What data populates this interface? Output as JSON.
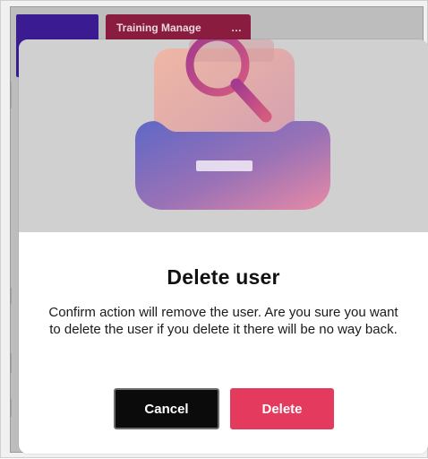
{
  "background": {
    "tab_label": "Training Manage",
    "tab_ellipsis": "…"
  },
  "modal": {
    "title": "Delete user",
    "body": "Confirm action will remove the user. Are you sure you want to delete the user if you delete it there will be no way back.",
    "buttons": {
      "cancel": "Cancel",
      "delete": "Delete"
    },
    "icons": {
      "hero": "inbox-search-illustration"
    }
  },
  "colors": {
    "accent_delete": "#e33a5d",
    "cancel_bg": "#0b0b0b",
    "background_purple": "#3b1b92",
    "background_tab": "#8a1d3f"
  }
}
